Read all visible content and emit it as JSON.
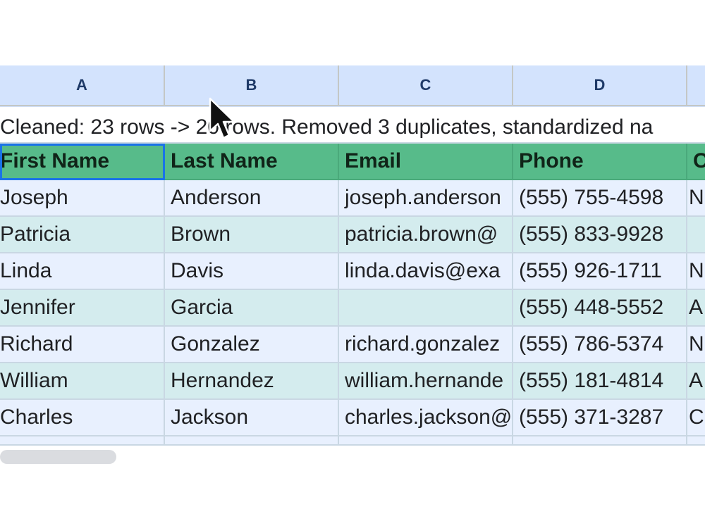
{
  "columns": [
    "A",
    "B",
    "C",
    "D",
    ""
  ],
  "caption": "Cleaned: 23 rows -> 20 rows. Removed 3 duplicates, standardized na",
  "headers": [
    "First Name",
    "Last Name",
    "Email",
    "Phone",
    "C"
  ],
  "rows": [
    [
      "Joseph",
      "Anderson",
      "joseph.anderson",
      "(555) 755-4598",
      "N"
    ],
    [
      "Patricia",
      "Brown",
      "patricia.brown@",
      "(555) 833-9928",
      ""
    ],
    [
      "Linda",
      "Davis",
      "linda.davis@exa",
      "(555) 926-1711",
      "N"
    ],
    [
      "Jennifer",
      "Garcia",
      "",
      "(555) 448-5552",
      "A"
    ],
    [
      "Richard",
      "Gonzalez",
      "richard.gonzalez",
      "(555) 786-5374",
      "N"
    ],
    [
      "William",
      "Hernandez",
      "william.hernande",
      "(555) 181-4814",
      "A"
    ],
    [
      "Charles",
      "Jackson",
      "charles.jackson@",
      "(555) 371-3287",
      "C"
    ]
  ],
  "cursor_icon": "arrow-pointer-icon",
  "colors": {
    "header_green": "#57bb8a",
    "col_header_blue": "#d3e3fd",
    "row_odd": "#e8f0fe",
    "row_even": "#d4ecee",
    "selection": "#1a73e8"
  }
}
